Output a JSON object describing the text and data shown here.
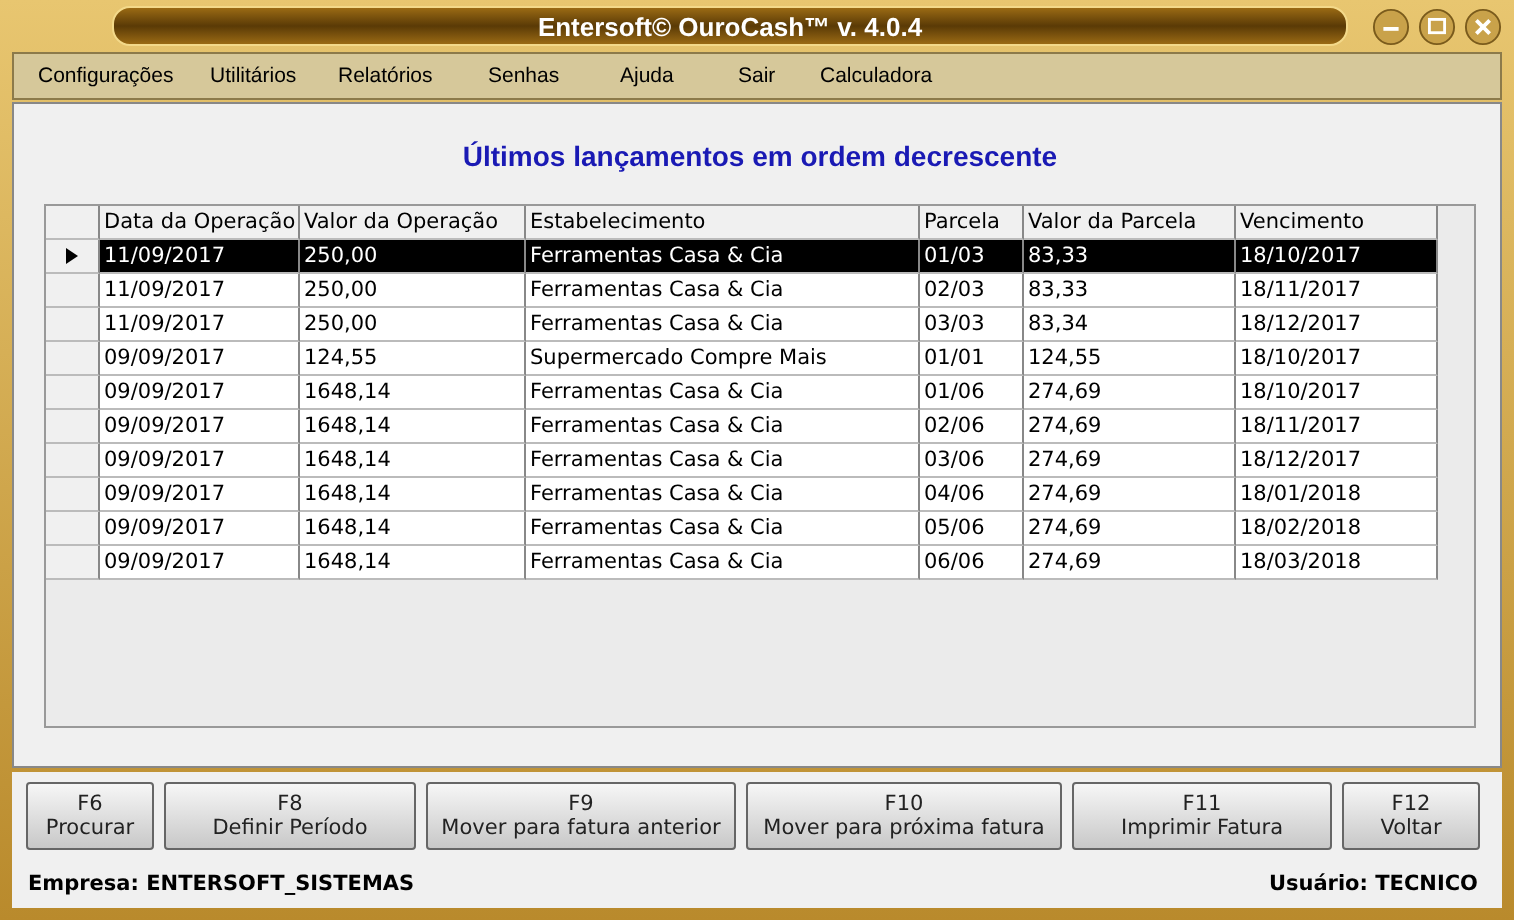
{
  "window": {
    "title": "Entersoft© OuroCash™ v. 4.0.4"
  },
  "menu": [
    "Configurações",
    "Utilitários",
    "Relatórios",
    "Senhas",
    "Ajuda",
    "Sair",
    "Calculadora"
  ],
  "heading": "Últimos lançamentos em ordem decrescente",
  "table": {
    "columns": [
      "Data da Operação",
      "Valor da Operação",
      "Estabelecimento",
      "Parcela",
      "Valor da Parcela",
      "Vencimento"
    ],
    "rows": [
      {
        "selected": true,
        "cells": [
          "11/09/2017",
          "250,00",
          "Ferramentas Casa & Cia",
          "01/03",
          "83,33",
          "18/10/2017"
        ]
      },
      {
        "selected": false,
        "cells": [
          "11/09/2017",
          "250,00",
          "Ferramentas Casa & Cia",
          "02/03",
          "83,33",
          "18/11/2017"
        ]
      },
      {
        "selected": false,
        "cells": [
          "11/09/2017",
          "250,00",
          "Ferramentas Casa & Cia",
          "03/03",
          "83,34",
          "18/12/2017"
        ]
      },
      {
        "selected": false,
        "cells": [
          "09/09/2017",
          "124,55",
          "Supermercado Compre Mais",
          "01/01",
          "124,55",
          "18/10/2017"
        ]
      },
      {
        "selected": false,
        "cells": [
          "09/09/2017",
          "1648,14",
          "Ferramentas Casa & Cia",
          "01/06",
          "274,69",
          "18/10/2017"
        ]
      },
      {
        "selected": false,
        "cells": [
          "09/09/2017",
          "1648,14",
          "Ferramentas Casa & Cia",
          "02/06",
          "274,69",
          "18/11/2017"
        ]
      },
      {
        "selected": false,
        "cells": [
          "09/09/2017",
          "1648,14",
          "Ferramentas Casa & Cia",
          "03/06",
          "274,69",
          "18/12/2017"
        ]
      },
      {
        "selected": false,
        "cells": [
          "09/09/2017",
          "1648,14",
          "Ferramentas Casa & Cia",
          "04/06",
          "274,69",
          "18/01/2018"
        ]
      },
      {
        "selected": false,
        "cells": [
          "09/09/2017",
          "1648,14",
          "Ferramentas Casa & Cia",
          "05/06",
          "274,69",
          "18/02/2018"
        ]
      },
      {
        "selected": false,
        "cells": [
          "09/09/2017",
          "1648,14",
          "Ferramentas Casa & Cia",
          "06/06",
          "274,69",
          "18/03/2018"
        ]
      }
    ]
  },
  "buttons": [
    {
      "key": "F6",
      "label": "Procurar"
    },
    {
      "key": "F8",
      "label": "Definir Período"
    },
    {
      "key": "F9",
      "label": "Mover para fatura anterior"
    },
    {
      "key": "F10",
      "label": "Mover para próxima fatura"
    },
    {
      "key": "F11",
      "label": "Imprimir Fatura"
    },
    {
      "key": "F12",
      "label": "Voltar"
    }
  ],
  "status_bar": {
    "company": "Empresa: ENTERSOFT_SISTEMAS",
    "user": "Usuário: TECNICO"
  }
}
